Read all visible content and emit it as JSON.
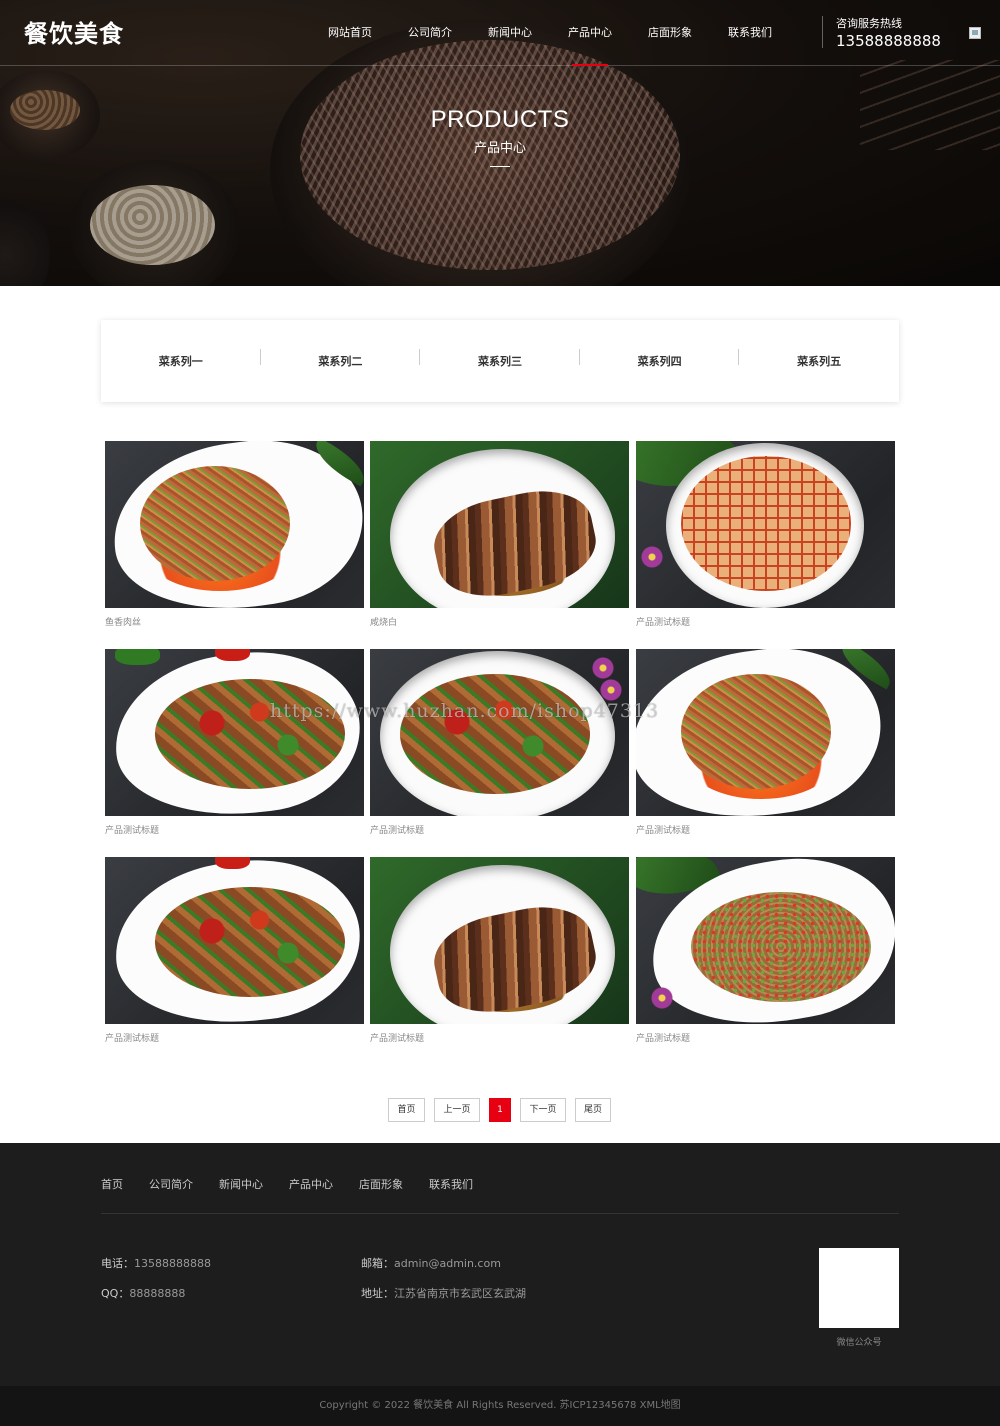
{
  "header": {
    "logo": "餐饮美食",
    "nav": [
      "网站首页",
      "公司简介",
      "新闻中心",
      "产品中心",
      "店面形象",
      "联系我们"
    ],
    "active_nav": "产品中心",
    "hotline_label": "咨询服务热线",
    "hotline_number": "13588888888"
  },
  "hero": {
    "title_en": "PRODUCTS",
    "title_cn": "产品中心"
  },
  "categories": [
    "菜系列一",
    "菜系列二",
    "菜系列三",
    "菜系列四",
    "菜系列五"
  ],
  "products": [
    {
      "title": "鱼香肉丝",
      "image": "shredded-pork-dish"
    },
    {
      "title": "咸烧白",
      "image": "braised-pork-belly-dish"
    },
    {
      "title": "产品测试标题",
      "image": "mapo-tofu-dish"
    },
    {
      "title": "产品测试标题",
      "image": "stir-fried-pork-pepper-dish"
    },
    {
      "title": "产品测试标题",
      "image": "twice-cooked-pork-dish"
    },
    {
      "title": "产品测试标题",
      "image": "shredded-pork-dish"
    },
    {
      "title": "产品测试标题",
      "image": "stir-fried-pork-pepper-dish"
    },
    {
      "title": "产品测试标题",
      "image": "braised-pork-belly-dish"
    },
    {
      "title": "产品测试标题",
      "image": "minced-pork-pepper-dish"
    }
  ],
  "pagination": {
    "first": "首页",
    "prev": "上一页",
    "current": "1",
    "next": "下一页",
    "last": "尾页"
  },
  "footer": {
    "nav": [
      "首页",
      "公司简介",
      "新闻中心",
      "产品中心",
      "店面形象",
      "联系我们"
    ],
    "phone_label": "电话：",
    "phone": "13588888888",
    "qq_label": "QQ：",
    "qq": "88888888",
    "email_label": "邮箱：",
    "email": "admin@admin.com",
    "address_label": "地址：",
    "address": "江苏省南京市玄武区玄武湖",
    "qr_caption": "微信公众号",
    "copyright": "Copyright © 2022 餐饮美食 All Rights Reserved. 苏ICP12345678 XML地图"
  },
  "watermark": "https://www.huzhan.com/ishop47313",
  "colors": {
    "accent": "#e60012",
    "footer_bg": "#1d1d1d"
  }
}
